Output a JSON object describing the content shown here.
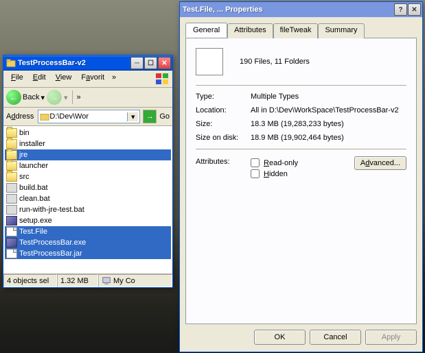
{
  "explorer": {
    "title": "TestProcessBar-v2",
    "menu": [
      "File",
      "Edit",
      "View",
      "Favorit"
    ],
    "menu_chevron": "»",
    "back_label": "Back",
    "addr_label": "Address",
    "addr_value": "D:\\Dev\\Wor",
    "go_label": "Go",
    "items": [
      {
        "name": "bin",
        "type": "folder",
        "selected": false
      },
      {
        "name": "installer",
        "type": "folder",
        "selected": false
      },
      {
        "name": "jre",
        "type": "folder",
        "selected": true
      },
      {
        "name": "launcher",
        "type": "folder",
        "selected": false
      },
      {
        "name": "src",
        "type": "folder",
        "selected": false
      },
      {
        "name": "build.bat",
        "type": "bat",
        "selected": false
      },
      {
        "name": "clean.bat",
        "type": "bat",
        "selected": false
      },
      {
        "name": "run-with-jre-test.bat",
        "type": "bat",
        "selected": false
      },
      {
        "name": "setup.exe",
        "type": "exe",
        "selected": false
      },
      {
        "name": "Test.File",
        "type": "file",
        "selected": true
      },
      {
        "name": "TestProcessBar.exe",
        "type": "exe",
        "selected": true
      },
      {
        "name": "TestProcessBar.jar",
        "type": "file",
        "selected": true
      }
    ],
    "status": {
      "sel": "4 objects sel",
      "size": "1.32 MB",
      "loc": "My Co"
    }
  },
  "props": {
    "title": "Test.File, ... Properties",
    "tabs": [
      "General",
      "Attributes",
      "fileTweak",
      "Summary"
    ],
    "active_tab": 0,
    "summary": "190 Files, 11 Folders",
    "rows": {
      "type_lbl": "Type:",
      "type_val": "Multiple Types",
      "loc_lbl": "Location:",
      "loc_val": "All in D:\\Dev\\WorkSpace\\TestProcessBar-v2",
      "size_lbl": "Size:",
      "size_val": "18.3 MB (19,283,233 bytes)",
      "disk_lbl": "Size on disk:",
      "disk_val": "18.9 MB (19,902,464 bytes)"
    },
    "attr_lbl": "Attributes:",
    "readonly_lbl": "Read-only",
    "hidden_lbl": "Hidden",
    "advanced_lbl": "Advanced...",
    "ok": "OK",
    "cancel": "Cancel",
    "apply": "Apply"
  }
}
